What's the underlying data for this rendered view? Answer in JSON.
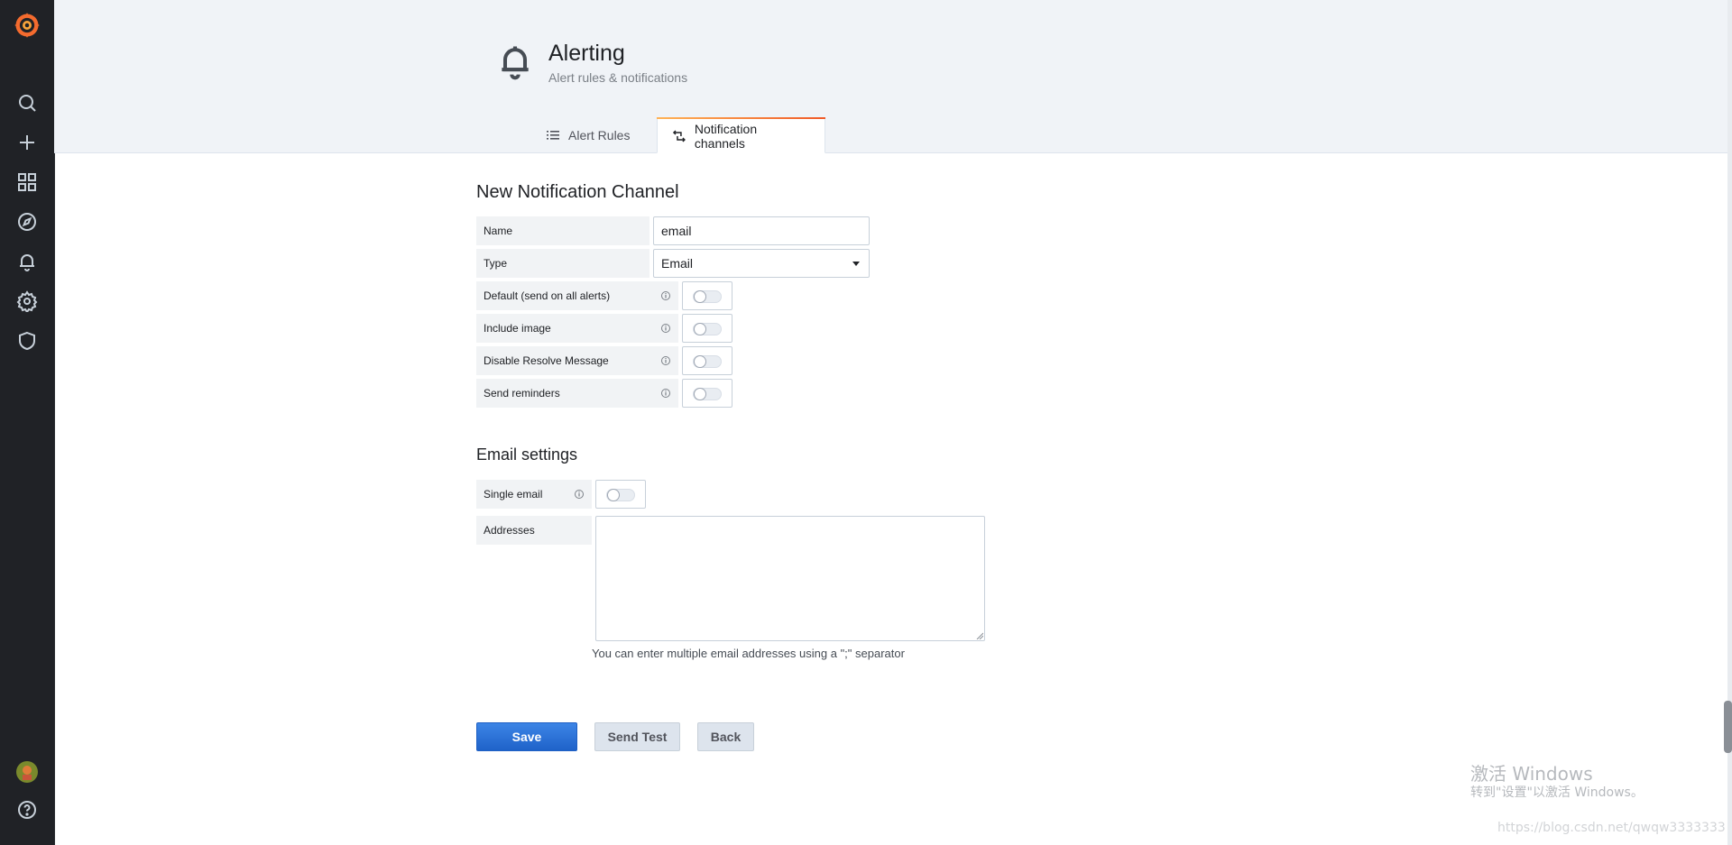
{
  "sidebar": {
    "icons": [
      "grafana-logo-icon",
      "search-icon",
      "plus-icon",
      "dashboards-icon",
      "explore-icon",
      "alerting-bell-icon",
      "gear-icon",
      "shield-icon",
      "user-avatar-icon",
      "help-icon"
    ]
  },
  "header": {
    "title": "Alerting",
    "subtitle": "Alert rules & notifications",
    "tabs": [
      {
        "label": "Alert Rules",
        "icon": "list-icon",
        "active": false
      },
      {
        "label": "Notification channels",
        "icon": "channels-icon",
        "active": true
      }
    ]
  },
  "form": {
    "title": "New Notification Channel",
    "name_label": "Name",
    "name_value": "email",
    "type_label": "Type",
    "type_value": "Email",
    "toggles": [
      {
        "label": "Default (send on all alerts)",
        "on": false
      },
      {
        "label": "Include image",
        "on": false
      },
      {
        "label": "Disable Resolve Message",
        "on": false
      },
      {
        "label": "Send reminders",
        "on": false
      }
    ]
  },
  "email_settings": {
    "title": "Email settings",
    "single_email_label": "Single email",
    "single_email_on": false,
    "addresses_label": "Addresses",
    "addresses_value": "",
    "hint": "You can enter multiple email addresses using a \";\" separator"
  },
  "buttons": {
    "save": "Save",
    "send_test": "Send Test",
    "back": "Back"
  },
  "watermark": {
    "line1": "激活 Windows",
    "line2": "转到\"设置\"以激活 Windows。",
    "url": "https://blog.csdn.net/qwqw3333333"
  },
  "colors": {
    "sidebar_bg": "#202226",
    "header_bg": "#f0f3f7",
    "primary": "#3274d9",
    "tab_accent": "#f59342"
  }
}
